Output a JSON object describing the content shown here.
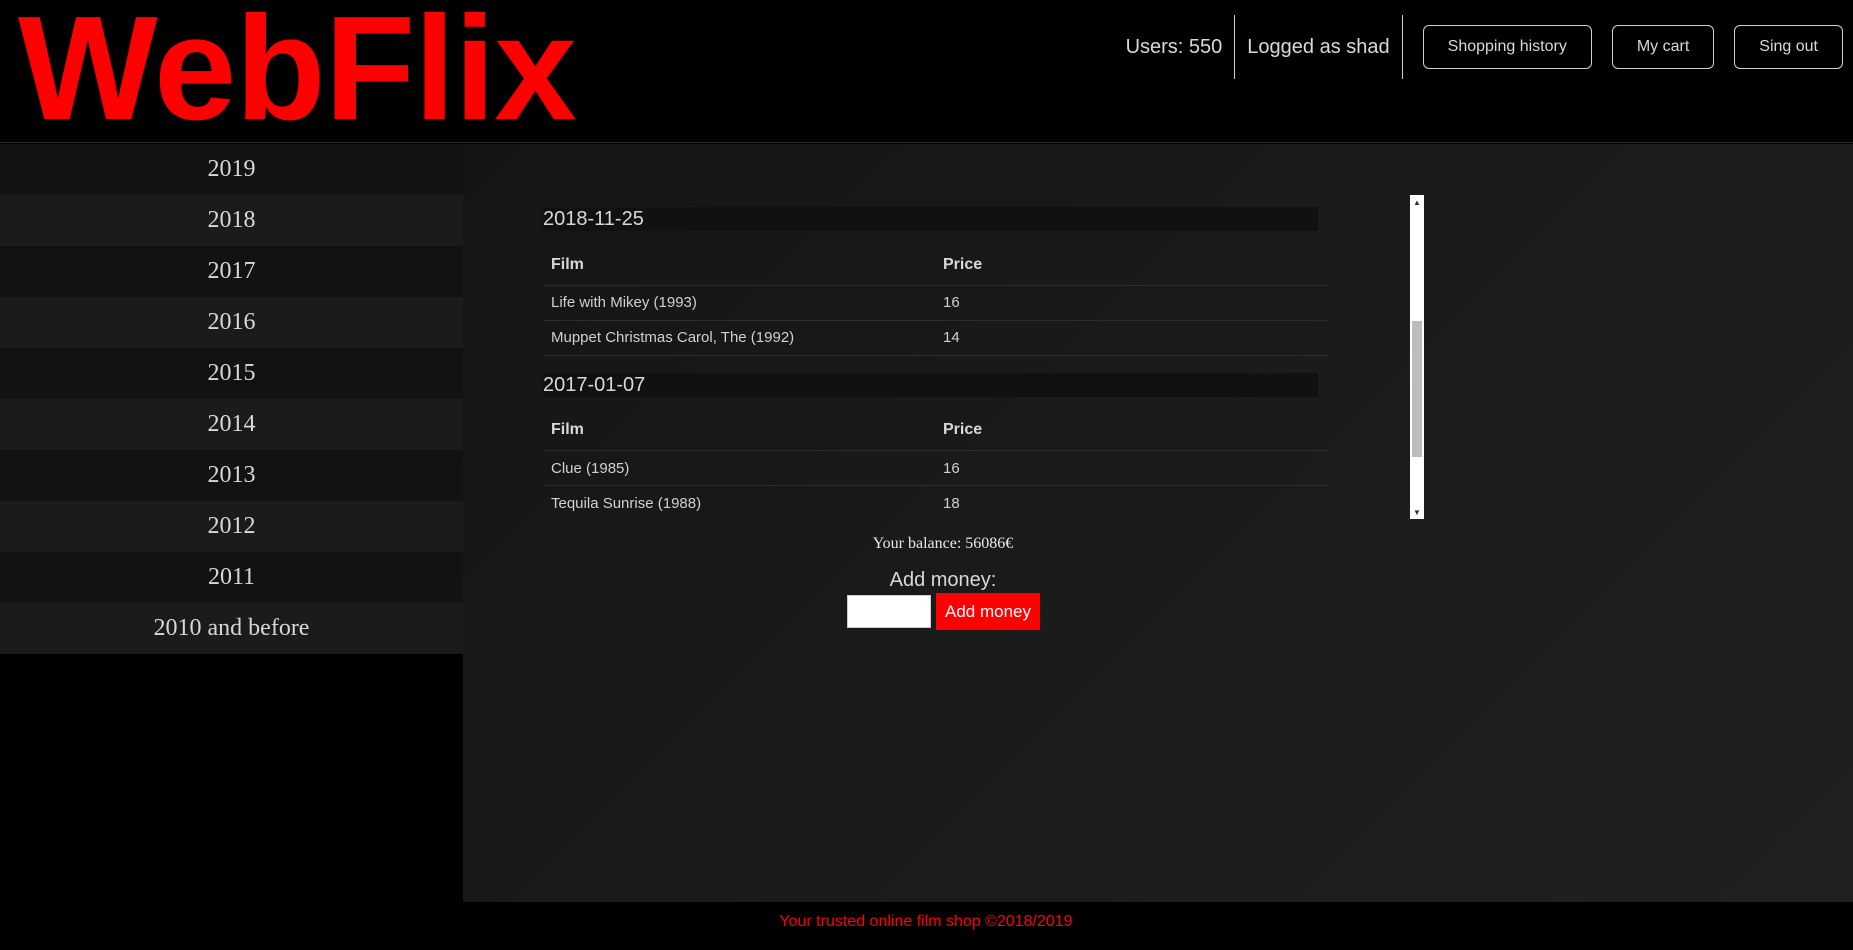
{
  "header": {
    "logo": "WebFlix",
    "users": "Users: 550",
    "logged_as": "Logged as shad",
    "buttons": {
      "history": "Shopping history",
      "cart": "My cart",
      "signout": "Sing out"
    }
  },
  "sidebar": {
    "items": [
      {
        "label": "2019"
      },
      {
        "label": "2018"
      },
      {
        "label": "2017"
      },
      {
        "label": "2016"
      },
      {
        "label": "2015"
      },
      {
        "label": "2014"
      },
      {
        "label": "2013"
      },
      {
        "label": "2012"
      },
      {
        "label": "2011"
      },
      {
        "label": "2010 and before"
      }
    ]
  },
  "history": {
    "columns": {
      "film": "Film",
      "price": "Price"
    },
    "orders": [
      {
        "date": "2018-11-25",
        "rows": [
          {
            "film": "Life with Mikey (1993)",
            "price": "16"
          },
          {
            "film": "Muppet Christmas Carol, The (1992)",
            "price": "14"
          }
        ]
      },
      {
        "date": "2017-01-07",
        "rows": [
          {
            "film": "Clue (1985)",
            "price": "16"
          },
          {
            "film": "Tequila Sunrise (1988)",
            "price": "18"
          }
        ]
      }
    ],
    "scroll_position": 0.45
  },
  "balance": {
    "text": "Your balance: 56086€"
  },
  "add_money": {
    "label": "Add money:",
    "input_value": "",
    "button": "Add money"
  },
  "footer": {
    "text": "Your trusted online film shop ©2018/2019"
  },
  "colors": {
    "brand": "#ff0000",
    "background": "#000000",
    "panel": "#1c1c1c"
  },
  "icons": {
    "scroll_up": "triangle-up-icon",
    "scroll_down": "triangle-down-icon"
  }
}
